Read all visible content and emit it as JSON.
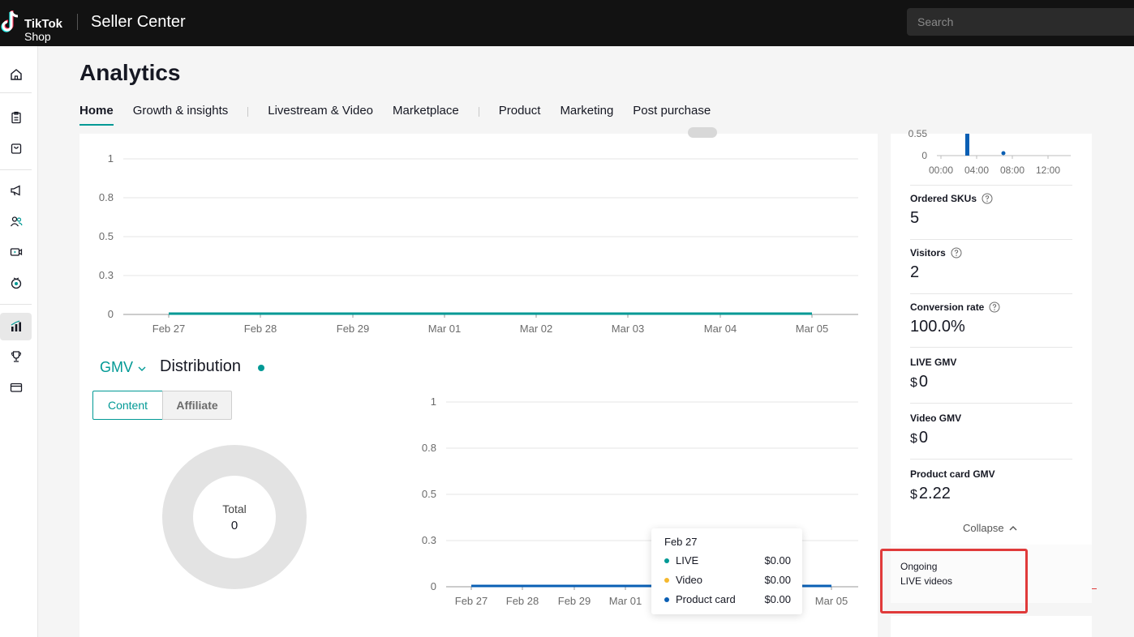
{
  "header": {
    "logo_line1": "TikTok",
    "logo_line2": "Shop",
    "app_title": "Seller Center",
    "search_placeholder": "Search"
  },
  "sidebar": {
    "items": [
      {
        "icon": "home-icon"
      },
      {
        "icon": "orders-icon"
      },
      {
        "icon": "products-icon"
      },
      {
        "icon": "marketing-megaphone-icon"
      },
      {
        "icon": "affiliate-users-icon"
      },
      {
        "icon": "video-icon"
      },
      {
        "icon": "live-icon"
      },
      {
        "icon": "analytics-icon",
        "active": true
      },
      {
        "icon": "trophy-icon"
      },
      {
        "icon": "finance-card-icon"
      }
    ]
  },
  "page": {
    "title": "Analytics",
    "tabs": [
      "Home",
      "Growth & insights",
      "Livestream & Video",
      "Marketplace",
      "Product",
      "Marketing",
      "Post purchase"
    ],
    "active_tab": "Home"
  },
  "top_chart": {
    "type": "line",
    "yticks": [
      "1",
      "0.8",
      "0.5",
      "0.3",
      "0"
    ],
    "xticks": [
      "Feb 27",
      "Feb 28",
      "Feb 29",
      "Mar 01",
      "Mar 02",
      "Mar 03",
      "Mar 04",
      "Mar 05"
    ],
    "line_color": "#009995"
  },
  "distribution": {
    "metric": "GMV",
    "title": "Distribution",
    "segments": [
      "Content",
      "Affiliate"
    ],
    "active_segment": "Content",
    "donut_label": "Total",
    "donut_value": "0"
  },
  "chart_data": [
    {
      "type": "line",
      "x": [
        "Feb 27",
        "Feb 28",
        "Feb 29",
        "Mar 01",
        "Mar 02",
        "Mar 03",
        "Mar 04",
        "Mar 05"
      ],
      "series": [
        {
          "values": [
            0,
            0,
            0,
            0,
            0,
            0,
            0,
            0
          ],
          "color": "#009995"
        }
      ],
      "ylim": [
        0,
        1
      ],
      "yticks": [
        0,
        0.3,
        0.5,
        0.8,
        1
      ]
    },
    {
      "type": "line",
      "x": [
        "Feb 27",
        "Feb 28",
        "Feb 29",
        "Mar 01",
        "Mar 02",
        "Mar 03",
        "Mar 04",
        "Mar 05"
      ],
      "series": [
        {
          "name": "LIVE",
          "values": [
            0,
            0,
            0,
            0,
            0,
            0,
            0,
            0
          ],
          "color": "#009995"
        },
        {
          "name": "Video",
          "values": [
            0,
            0,
            0,
            0,
            0,
            0,
            0,
            0
          ],
          "color": "#f5b82e"
        },
        {
          "name": "Product card",
          "values": [
            0,
            0,
            0,
            0,
            0,
            0,
            0,
            0
          ],
          "color": "#0a5fb4"
        }
      ],
      "ylim": [
        0,
        1
      ],
      "yticks": [
        0,
        0.3,
        0.5,
        0.8,
        1
      ]
    },
    {
      "type": "pie",
      "slices": [],
      "center_label": "Total",
      "center_value": 0
    }
  ],
  "dist_chart": {
    "yticks": [
      "1",
      "0.8",
      "0.5",
      "0.3",
      "0"
    ],
    "xticks": [
      "Feb 27",
      "Feb 28",
      "Feb 29",
      "Mar 01",
      "Mar 05"
    ]
  },
  "tooltip": {
    "date": "Feb 27",
    "rows": [
      {
        "name": "LIVE",
        "value": "$0.00",
        "color": "#009995"
      },
      {
        "name": "Video",
        "value": "$0.00",
        "color": "#f5b82e"
      },
      {
        "name": "Product card",
        "value": "$0.00",
        "color": "#0a5fb4"
      }
    ]
  },
  "side": {
    "mini_chart": {
      "ytick_top": "0.55",
      "ytick_zero": "0",
      "xticks": [
        "00:00",
        "04:00",
        "08:00",
        "12:00"
      ]
    },
    "metrics": [
      {
        "label": "Ordered SKUs",
        "value": "5",
        "help": true
      },
      {
        "label": "Visitors",
        "value": "2",
        "help": true
      },
      {
        "label": "Conversion rate",
        "value": "100.0%",
        "help": true
      },
      {
        "label": "LIVE GMV",
        "currency": "$",
        "value": "0"
      },
      {
        "label": "Video GMV",
        "currency": "$",
        "value": "0"
      },
      {
        "label": "Product card GMV",
        "currency": "$",
        "value": "2.22"
      }
    ],
    "collapse_label": "Collapse",
    "ongoing_line1": "Ongoing",
    "ongoing_line2": "LIVE videos"
  },
  "colors": {
    "accent": "#009995",
    "highlight": "#e03a3a",
    "topbar": "#121212"
  }
}
